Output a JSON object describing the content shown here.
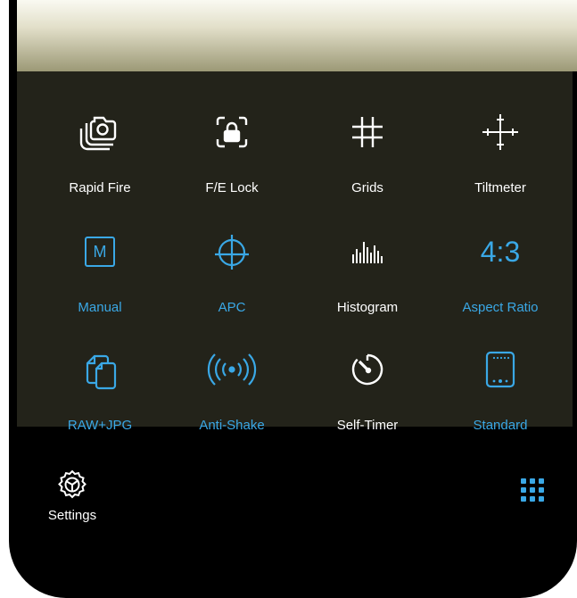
{
  "colors": {
    "accent": "#3aa8e6",
    "panel": "#23231a",
    "text": "#ffffff"
  },
  "tiles": [
    {
      "label": "Rapid Fire",
      "icon": "rapid-fire-icon",
      "active": false
    },
    {
      "label": "F/E Lock",
      "icon": "lock-icon",
      "active": false
    },
    {
      "label": "Grids",
      "icon": "grid-icon",
      "active": false
    },
    {
      "label": "Tiltmeter",
      "icon": "tiltmeter-icon",
      "active": false
    },
    {
      "label": "Manual",
      "icon": "manual-icon",
      "active": true,
      "icon_text": "M"
    },
    {
      "label": "APC",
      "icon": "apc-icon",
      "active": true
    },
    {
      "label": "Histogram",
      "icon": "histogram-icon",
      "active": false
    },
    {
      "label": "Aspect Ratio",
      "icon": "aspect-ratio-icon",
      "active": true,
      "icon_text": "4:3"
    },
    {
      "label": "RAW+JPG",
      "icon": "raw-jpg-icon",
      "active": true
    },
    {
      "label": "Anti-Shake",
      "icon": "anti-shake-icon",
      "active": true
    },
    {
      "label": "Self-Timer",
      "icon": "timer-icon",
      "active": false
    },
    {
      "label": "Standard",
      "icon": "standard-icon",
      "active": true
    }
  ],
  "bottom": {
    "settings_label": "Settings"
  }
}
